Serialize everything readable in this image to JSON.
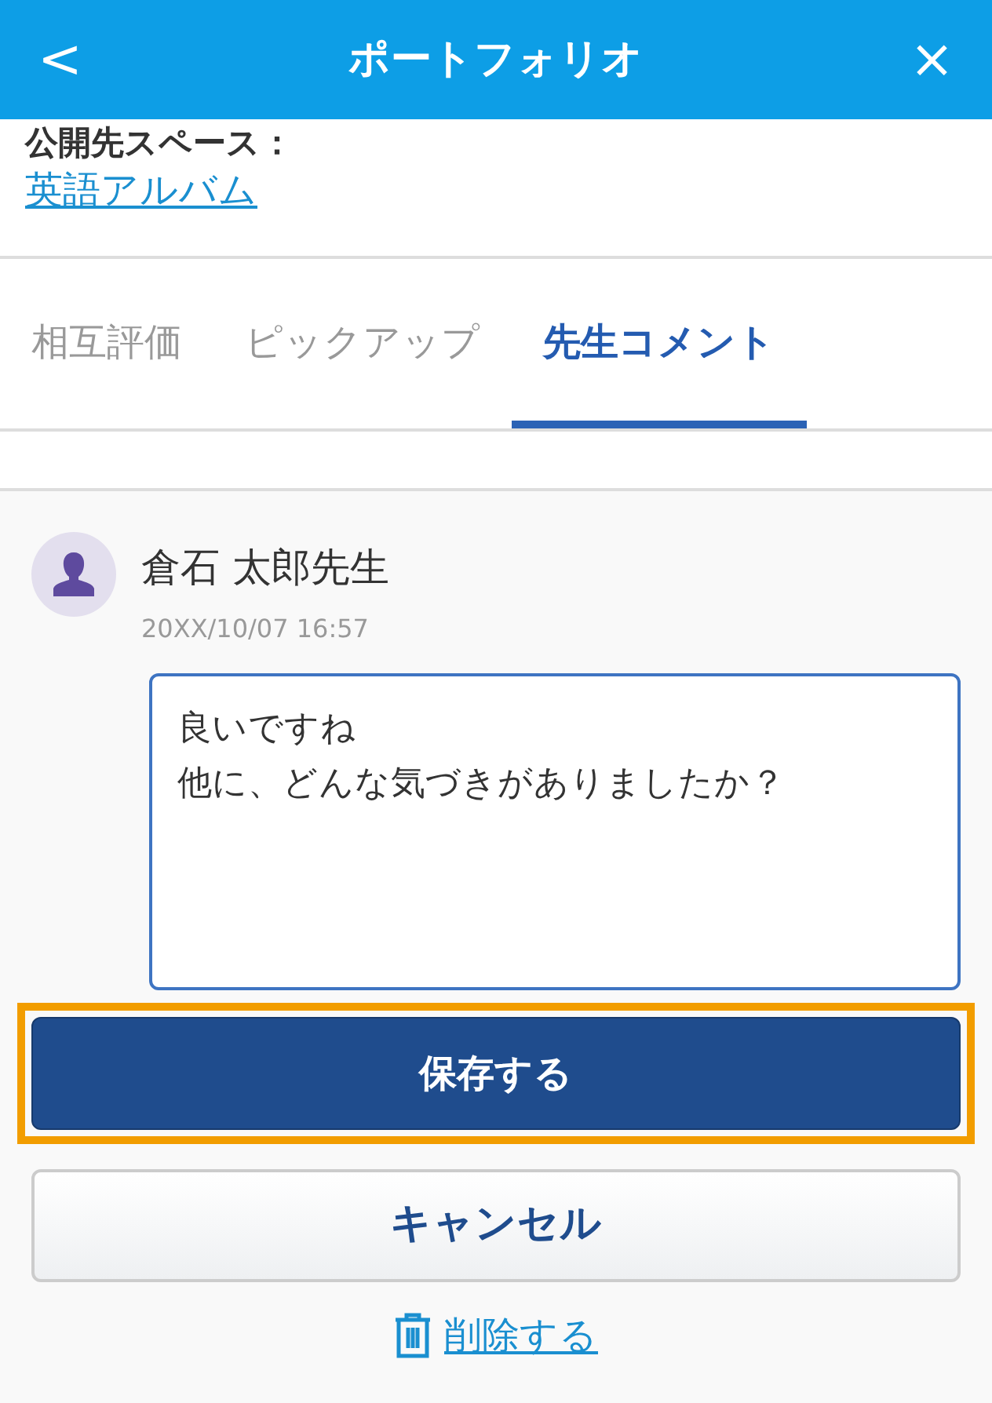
{
  "header": {
    "back": "<",
    "title": "ポートフォリオ",
    "close": "×"
  },
  "space": {
    "label": "公開先スペース：",
    "link": "英語アルバム"
  },
  "tabs": [
    {
      "label": "相互評価",
      "selected": false
    },
    {
      "label": "ピックアップ",
      "selected": false
    },
    {
      "label": "先生コメント",
      "selected": true
    }
  ],
  "comment": {
    "author": "倉石 太郎先生",
    "time": "20XX/10/07 16:57",
    "lines": [
      "良いですね",
      "他に、どんな気づきがありましたか？"
    ]
  },
  "buttons": [
    {
      "kind": "primary",
      "label": "保存する",
      "highlighted": true
    },
    {
      "kind": "secondary",
      "label": "キャンセル",
      "highlighted": false
    }
  ],
  "delete": {
    "label": "削除する"
  }
}
